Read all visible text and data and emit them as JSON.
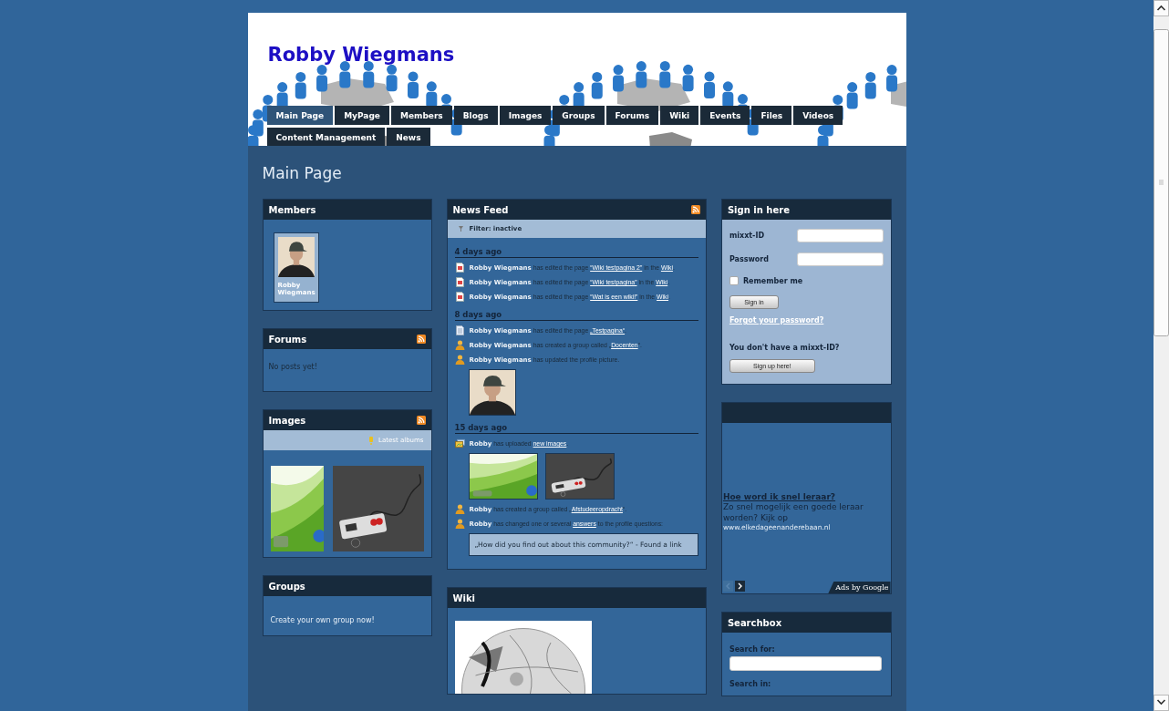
{
  "header": {
    "title": "Robby Wiegmans",
    "nav": [
      {
        "label": "Main Page",
        "selected": true
      },
      {
        "label": "MyPage",
        "selected": false
      },
      {
        "label": "Members",
        "selected": false
      },
      {
        "label": "Blogs",
        "selected": false
      },
      {
        "label": "Images",
        "selected": false
      },
      {
        "label": "Groups",
        "selected": false
      },
      {
        "label": "Forums",
        "selected": false
      },
      {
        "label": "Wiki",
        "selected": false
      },
      {
        "label": "Events",
        "selected": false
      },
      {
        "label": "Files",
        "selected": false
      },
      {
        "label": "Videos",
        "selected": false
      },
      {
        "label": "Content Management",
        "selected": false
      },
      {
        "label": "News",
        "selected": false
      }
    ]
  },
  "page_title": "Main Page",
  "members": {
    "title": "Members",
    "items": [
      {
        "name": "Robby Wiegmans"
      }
    ]
  },
  "forums": {
    "title": "Forums",
    "rss": true,
    "empty_text": "No posts yet!"
  },
  "images": {
    "title": "Images",
    "rss": true,
    "albums_link": "Latest albums"
  },
  "groups": {
    "title": "Groups",
    "link": "Create your own group now!"
  },
  "news_feed": {
    "title": "News Feed",
    "rss": true,
    "filter": "Filter: inactive",
    "sections": [
      {
        "heading": "4 days ago",
        "entries": [
          {
            "kind": "page",
            "parts": [
              {
                "kind": "actor",
                "text": "Robby Wiegmans"
              },
              {
                "kind": "text",
                "text": " has edited the page "
              },
              {
                "kind": "link",
                "text": "“Wiki testpagina 2”"
              },
              {
                "kind": "text",
                "text": " in the "
              },
              {
                "kind": "link",
                "text": "Wiki"
              },
              {
                "kind": "text",
                "text": "."
              }
            ]
          },
          {
            "kind": "page",
            "parts": [
              {
                "kind": "actor",
                "text": "Robby Wiegmans"
              },
              {
                "kind": "text",
                "text": " has edited the page "
              },
              {
                "kind": "link",
                "text": "“Wiki testpagina”"
              },
              {
                "kind": "text",
                "text": " in the "
              },
              {
                "kind": "link",
                "text": "Wiki"
              },
              {
                "kind": "text",
                "text": "."
              }
            ]
          },
          {
            "kind": "page",
            "parts": [
              {
                "kind": "actor",
                "text": "Robby Wiegmans"
              },
              {
                "kind": "text",
                "text": " has edited the page "
              },
              {
                "kind": "link",
                "text": "“Wat is een wiki!”"
              },
              {
                "kind": "text",
                "text": " in the "
              },
              {
                "kind": "link",
                "text": "Wiki"
              },
              {
                "kind": "text",
                "text": "."
              }
            ]
          }
        ]
      },
      {
        "heading": "8 days ago",
        "entries": [
          {
            "kind": "document",
            "parts": [
              {
                "kind": "actor",
                "text": "Robby Wiegmans"
              },
              {
                "kind": "text",
                "text": " has edited the page "
              },
              {
                "kind": "link",
                "text": "„Testpagina“"
              },
              {
                "kind": "text",
                "text": "."
              }
            ]
          },
          {
            "kind": "user",
            "parts": [
              {
                "kind": "actor",
                "text": "Robby Wiegmans"
              },
              {
                "kind": "text",
                "text": " has created a group called „"
              },
              {
                "kind": "link",
                "text": "Docenten"
              },
              {
                "kind": "text",
                "text": "“."
              }
            ]
          },
          {
            "kind": "user",
            "parts": [
              {
                "kind": "actor",
                "text": "Robby Wiegmans"
              },
              {
                "kind": "text",
                "text": " has updated the profile picture."
              }
            ],
            "photos": [
              {
                "kind": "avatar"
              }
            ]
          }
        ]
      },
      {
        "heading": "15 days ago",
        "entries": [
          {
            "kind": "images",
            "parts": [
              {
                "kind": "actor",
                "text": "Robby"
              },
              {
                "kind": "text",
                "text": " has uploaded "
              },
              {
                "kind": "link",
                "text": "new images"
              },
              {
                "kind": "text",
                "text": "."
              }
            ]
          },
          {
            "kind": "user",
            "parts": [
              {
                "kind": "actor",
                "text": "Robby"
              },
              {
                "kind": "text",
                "text": " has created a group called „"
              },
              {
                "kind": "link",
                "text": "Afstudeeropdracht"
              },
              {
                "kind": "text",
                "text": "“."
              }
            ]
          },
          {
            "kind": "user",
            "parts": [
              {
                "kind": "actor",
                "text": "Robby"
              },
              {
                "kind": "text",
                "text": " has changed one or several "
              },
              {
                "kind": "link",
                "text": "answers"
              },
              {
                "kind": "text",
                "text": " to the profile questions:"
              }
            ],
            "quote": "„How did you find out about this community?“ - Found a link"
          }
        ]
      }
    ]
  },
  "wiki": {
    "title": "Wiki"
  },
  "sign_in": {
    "title": "Sign in here",
    "fields": [
      {
        "label": "mixxt-ID"
      },
      {
        "label": "Password"
      }
    ],
    "remember": {
      "label": "Remember me",
      "checked": false
    },
    "submit": "Sign in",
    "forgot_link": "Forgot your password?",
    "signup_prompt": "You don't have a mixxt-ID?",
    "signup_button": "Sign up here!"
  },
  "ad": {
    "headline": "Hoe word ik snel leraar?",
    "body": "Zo snel mogelijk een goede leraar worden? Kijk op",
    "url": "www.elkedageenanderebaan.nl",
    "pager": [
      {
        "kind": "prev",
        "disabled": true
      },
      {
        "kind": "next",
        "disabled": false
      }
    ],
    "badge": "Ads by Google"
  },
  "searchbox": {
    "title": "Searchbox",
    "search_for_label": "Search for:",
    "search_in_label": "Search in:"
  }
}
